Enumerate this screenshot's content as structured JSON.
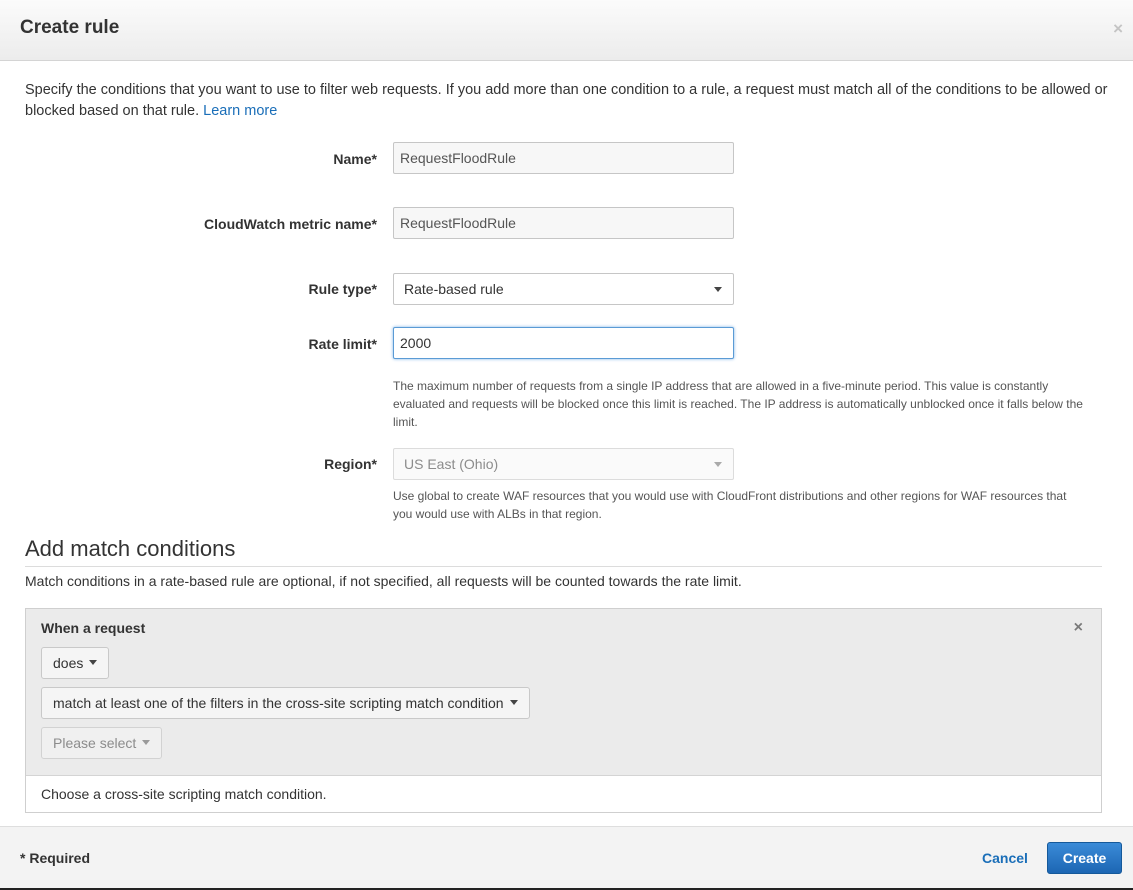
{
  "header": {
    "title": "Create rule",
    "close_glyph": "×"
  },
  "intro": {
    "text": "Specify the conditions that you want to use to filter web requests. If you add more than one condition to a rule, a request must match all of the conditions to be allowed or blocked based on that rule.",
    "link_label": "Learn more"
  },
  "form": {
    "name": {
      "label": "Name*",
      "value": "RequestFloodRule"
    },
    "metric": {
      "label": "CloudWatch metric name*",
      "value": "RequestFloodRule"
    },
    "rule_type": {
      "label": "Rule type*",
      "value": "Rate-based rule"
    },
    "rate_limit": {
      "label": "Rate limit*",
      "value": "2000",
      "help": "The maximum number of requests from a single IP address that are allowed in a five-minute period. This value is constantly evaluated and requests will be blocked once this limit is reached. The IP address is automatically unblocked once it falls below the limit."
    },
    "region": {
      "label": "Region*",
      "value": "US East (Ohio)",
      "help": "Use global to create WAF resources that you would use with CloudFront distributions and other regions for WAF resources that you would use with ALBs in that region."
    }
  },
  "match": {
    "title": "Add match conditions",
    "description": "Match conditions in a rate-based rule are optional, if not specified, all requests will be counted towards the rate limit.",
    "condition": {
      "title": "When a request",
      "close_glyph": "×",
      "does_label": "does",
      "match_type_label": "match at least one of the filters in the cross-site scripting match condition",
      "select_label": "Please select",
      "footer_text": "Choose a cross-site scripting match condition."
    }
  },
  "footer": {
    "required_note": "* Required",
    "cancel_label": "Cancel",
    "create_label": "Create"
  },
  "colors": {
    "link": "#1a6eb8",
    "primary_button": "#1d66b3",
    "focus_border": "#5b9bd5"
  }
}
